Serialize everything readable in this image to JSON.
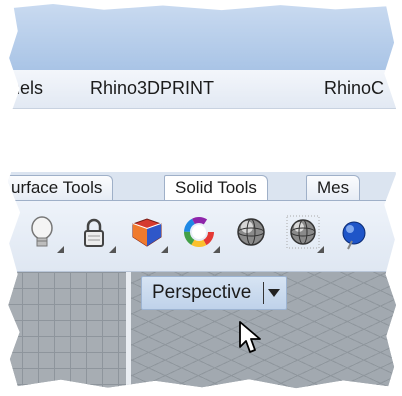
{
  "menubar": {
    "items": [
      {
        "label": "nels"
      },
      {
        "label": "Rhino3DPRINT"
      },
      {
        "label": "RhinoC"
      }
    ]
  },
  "tabs": [
    {
      "label": "urface Tools"
    },
    {
      "label": "Solid Tools"
    },
    {
      "label": "Mes"
    }
  ],
  "toolbar": {
    "tools": [
      {
        "icon": "lightbulb-icon"
      },
      {
        "icon": "lock-icon"
      },
      {
        "icon": "material-box-icon"
      },
      {
        "icon": "color-wheel-icon"
      },
      {
        "icon": "shaded-sphere-icon"
      },
      {
        "icon": "grid-sphere-icon"
      },
      {
        "icon": "blue-sphere-icon"
      }
    ]
  },
  "viewport": {
    "label": "Perspective"
  },
  "colors": {
    "title_bar": "#b8cfeb",
    "viewport_label_bg": "#c9d9ee",
    "viewport_grid": "#a2a9b0"
  }
}
